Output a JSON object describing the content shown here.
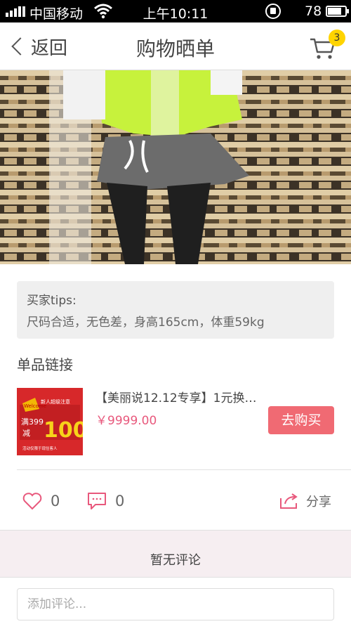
{
  "status_bar": {
    "carrier": "中国移动",
    "time": "上午10:11",
    "battery_percent": "78",
    "battery_level": 0.78,
    "wifi_icon": "wifi-icon",
    "lock_icon": "rotation-lock-icon"
  },
  "navbar": {
    "back_label": "返回",
    "title": "购物晒单",
    "cart_icon": "cart-icon",
    "cart_badge": "3"
  },
  "tips": {
    "label": "买家tips:",
    "text": "尺码合适，无色差，身高165cm，体重59kg"
  },
  "product_section": {
    "title": "单品链接",
    "name": "【美丽说12.12专享】1元换…",
    "price": "￥9999.00",
    "buy_label": "去购买",
    "thumb": {
      "badge": "Welcome",
      "line1": "新人超级注意",
      "line2": "满399",
      "line3": "减",
      "big": "100",
      "footer": "活动仅限于现住客人"
    }
  },
  "actions": {
    "likes": "0",
    "comments": "0",
    "share_label": "分享"
  },
  "comments": {
    "empty_text": "暂无评论",
    "input_placeholder": "添加评论..."
  },
  "colors": {
    "accent": "#f06a73",
    "price": "#e8587c",
    "badge": "#ffd400",
    "icon_pink": "#e8587c"
  }
}
